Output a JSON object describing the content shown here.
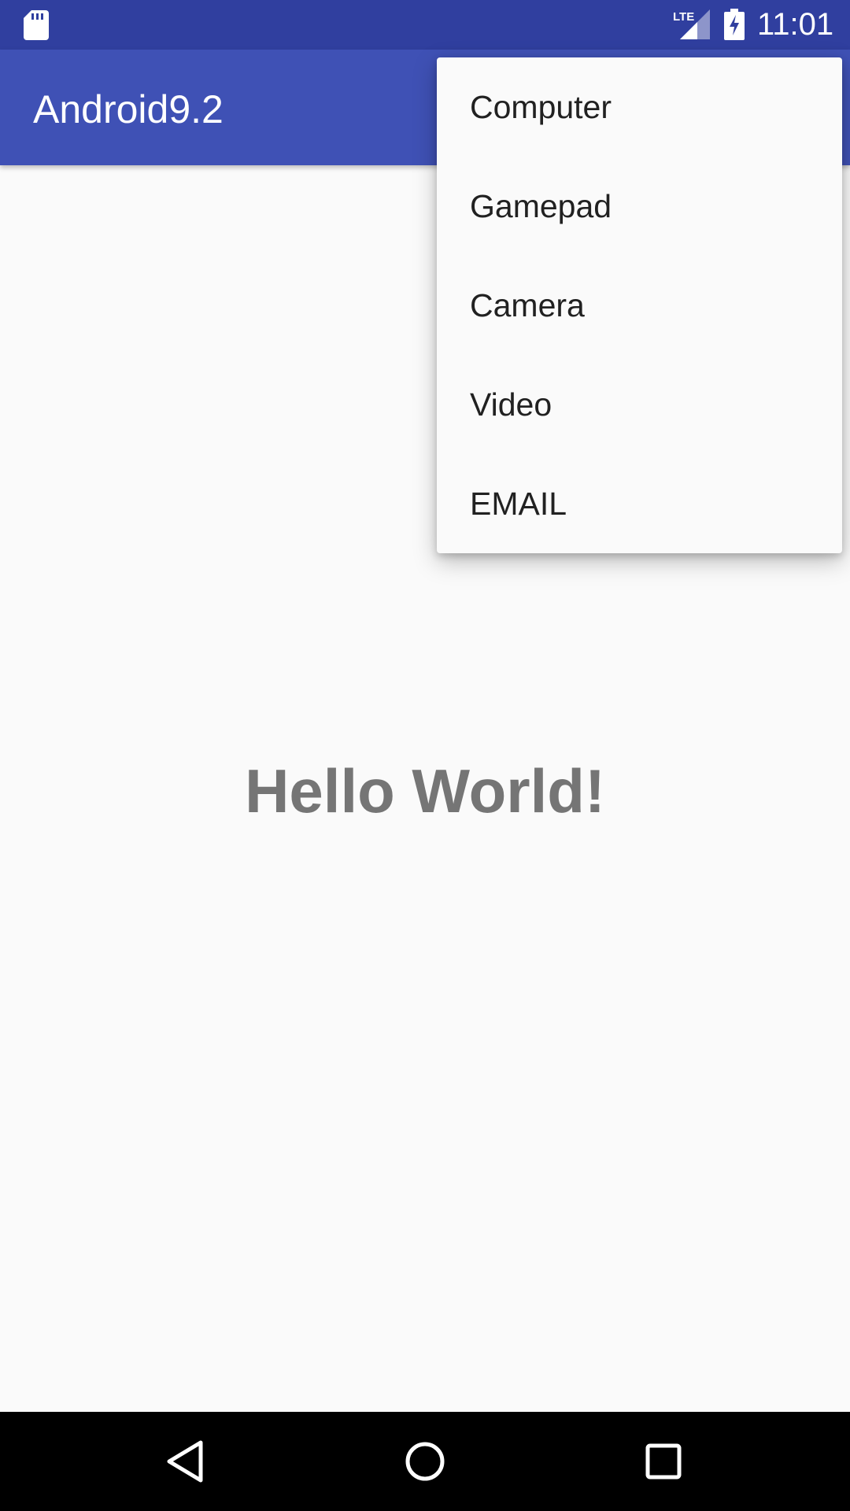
{
  "status_bar": {
    "time": "11:01",
    "network_label": "LTE",
    "icons": [
      "sd-card-icon",
      "lte-signal-icon",
      "battery-charging-icon"
    ]
  },
  "app_bar": {
    "title": "Android9.2",
    "background": "#3f51b5"
  },
  "main": {
    "text": "Hello World!"
  },
  "menu": {
    "items": [
      {
        "label": "Computer"
      },
      {
        "label": "Gamepad"
      },
      {
        "label": "Camera"
      },
      {
        "label": "Video"
      },
      {
        "label": "EMAIL"
      }
    ]
  },
  "nav_bar": {
    "icons": [
      "back-icon",
      "home-icon",
      "recents-icon"
    ]
  },
  "colors": {
    "status_bar": "#303f9f",
    "app_bar": "#3f51b5",
    "background": "#fafafa",
    "hello_text": "#757575"
  }
}
